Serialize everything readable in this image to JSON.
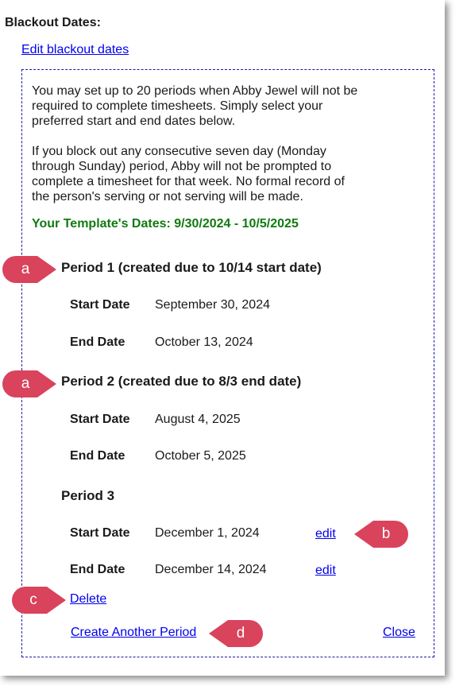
{
  "header": {
    "title": "Blackout Dates:",
    "edit_link": "Edit blackout dates"
  },
  "intro": {
    "paragraph1": "You may set up to 20 periods when Abby Jewel will not be required to complete timesheets. Simply select your preferred start and end dates below.",
    "paragraph2": "If you block out any consecutive seven day (Monday through Sunday) period, Abby will not be prompted to complete a timesheet for that week. No formal record of the person's serving or not serving will be made.",
    "template_dates": "Your Template's Dates: 9/30/2024 - 10/5/2025"
  },
  "periods": [
    {
      "title": "Period 1 (created due to 10/14 start date)",
      "start_label": "Start Date",
      "start_value": "September 30, 2024",
      "end_label": "End Date",
      "end_value": "October 13, 2024"
    },
    {
      "title": "Period 2 (created due to 8/3 end date)",
      "start_label": "Start Date",
      "start_value": "August 4, 2025",
      "end_label": "End Date",
      "end_value": "October 5, 2025"
    },
    {
      "title": "Period 3",
      "start_label": "Start Date",
      "start_value": "December 1, 2024",
      "start_edit": "edit",
      "end_label": "End Date",
      "end_value": "December 14, 2024",
      "end_edit": "edit"
    }
  ],
  "actions": {
    "delete": "Delete",
    "create": "Create Another Period",
    "close": "Close"
  },
  "callouts": {
    "a1": "a",
    "a2": "a",
    "b": "b",
    "c": "c",
    "d": "d"
  },
  "colors": {
    "callout": "#d9435c",
    "link": "#0000ee",
    "template_text": "#117a11",
    "dashed_border": "#1a1aa6"
  }
}
